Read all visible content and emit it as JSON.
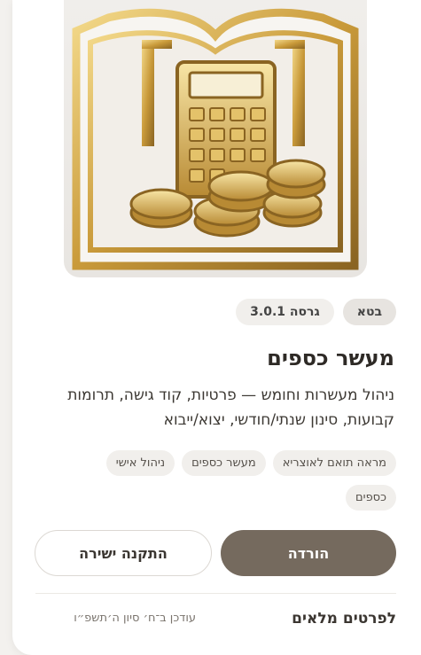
{
  "app": {
    "title": "מעשר כספים",
    "description": "ניהול מעשרות וחומש — פרטיות, קוד גישה, תרומות קבועות, סינון שנתי/חודשי, יצוא/ייבוא",
    "hero_image_icon": "gold-book-calculator-coins-icon"
  },
  "badges": {
    "beta": "בטא",
    "version": "גרסה 3.0.1"
  },
  "tags": [
    "מראה תואם לאוצריא",
    "מעשר כספים",
    "ניהול אישי",
    "כספים"
  ],
  "actions": {
    "download": "הורדה",
    "direct_install": "התקנה ישירה"
  },
  "footer": {
    "details_link": "לפרטים מלאים",
    "updated": "עודכן ב־ח׳ סיון ה׳תשפ״ו"
  },
  "colors": {
    "primary": "#756a5e",
    "gold": "#c9a24a",
    "chip_bg": "#f1efec"
  }
}
